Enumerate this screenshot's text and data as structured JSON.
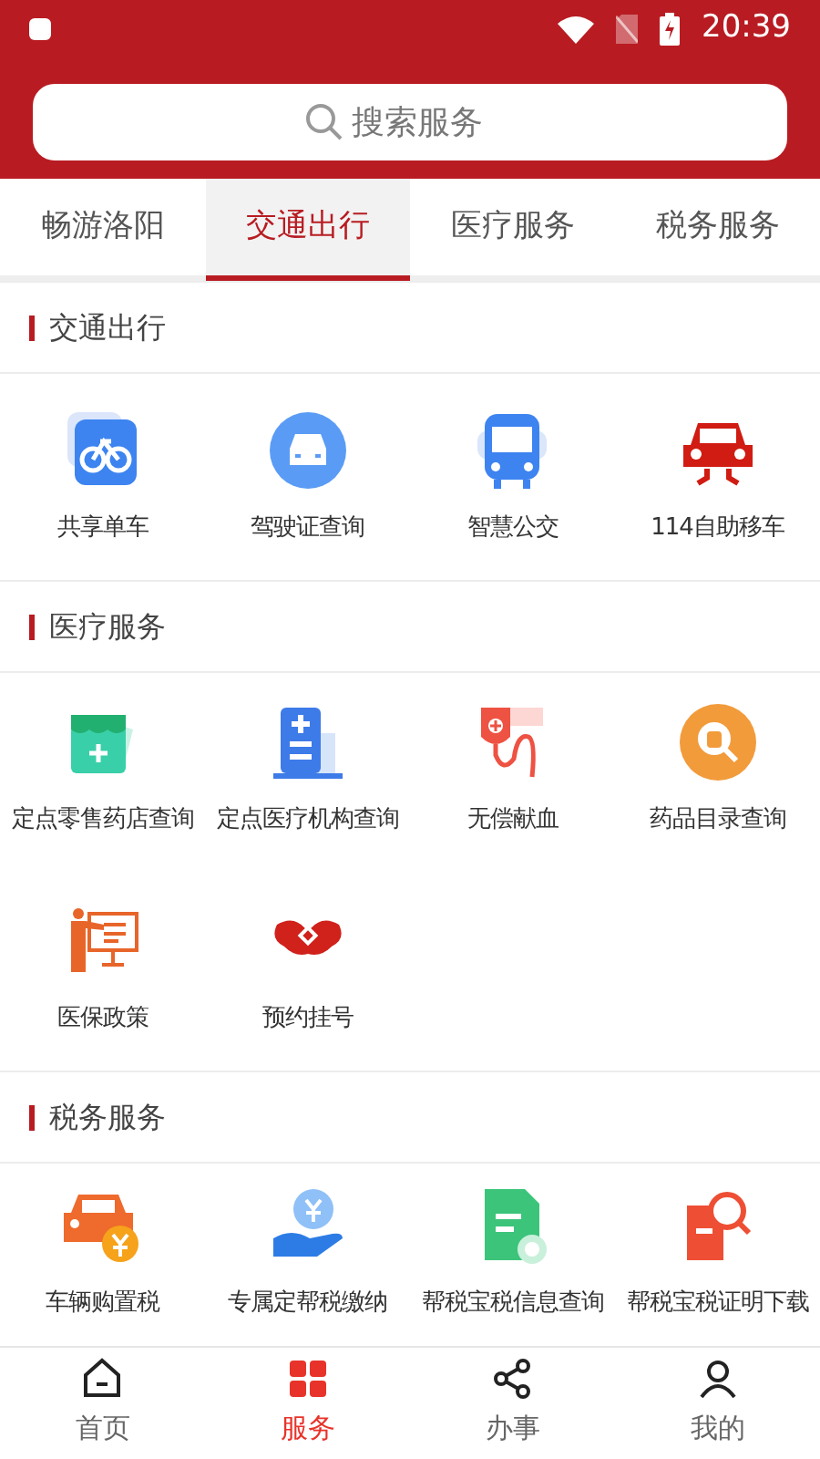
{
  "status_bar": {
    "time": "20:39"
  },
  "search": {
    "placeholder": "搜索服务"
  },
  "tabs": [
    {
      "label": "畅游洛阳",
      "selected": false
    },
    {
      "label": "交通出行",
      "selected": true
    },
    {
      "label": "医疗服务",
      "selected": false
    },
    {
      "label": "税务服务",
      "selected": false
    }
  ],
  "sections": [
    {
      "title": "交通出行",
      "items": [
        "共享单车",
        "驾驶证查询",
        "智慧公交",
        "114自助移车"
      ]
    },
    {
      "title": "医疗服务",
      "items": [
        "定点零售药店查询",
        "定点医疗机构查询",
        "无偿献血",
        "药品目录查询",
        "医保政策",
        "预约挂号"
      ]
    },
    {
      "title": "税务服务",
      "items": [
        "车辆购置税",
        "专属定帮税缴纳",
        "帮税宝税信息查询",
        "帮税宝税证明下载"
      ]
    }
  ],
  "bottom_nav": [
    {
      "label": "首页",
      "selected": false
    },
    {
      "label": "服务",
      "selected": true
    },
    {
      "label": "办事",
      "selected": false
    },
    {
      "label": "我的",
      "selected": false
    }
  ]
}
